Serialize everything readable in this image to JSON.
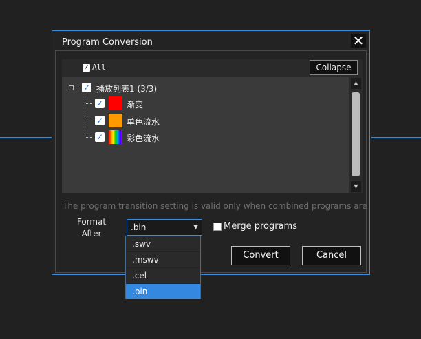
{
  "dialog": {
    "title": "Program Conversion",
    "close_glyph": "✕"
  },
  "tree": {
    "all_label": "All",
    "collapse_label": "Collapse",
    "playlist": {
      "label": "播放列表1 (3/3)",
      "checked": true,
      "children": [
        {
          "label": "渐变",
          "checked": true,
          "swatch": "#ff0000"
        },
        {
          "label": "单色流水",
          "checked": true,
          "swatch": "#ff9900"
        },
        {
          "label": "彩色流水",
          "checked": true,
          "swatch": "rainbow"
        }
      ]
    }
  },
  "info_text": "The program transition setting is valid only when combined programs are enabled",
  "format": {
    "label_line1": "Format",
    "label_line2": "After",
    "selected": ".bin",
    "options": [
      ".swv",
      ".mswv",
      ".cel",
      ".bin"
    ]
  },
  "merge": {
    "label": "Merge programs",
    "checked": false
  },
  "buttons": {
    "convert": "Convert",
    "cancel": "Cancel"
  },
  "colors": {
    "accent": "#3a8ee0",
    "selected_option": "#3488e0"
  },
  "icons": {
    "checkbox": "check-glyph",
    "close": "close-icon",
    "expander": "minus-box-icon"
  }
}
